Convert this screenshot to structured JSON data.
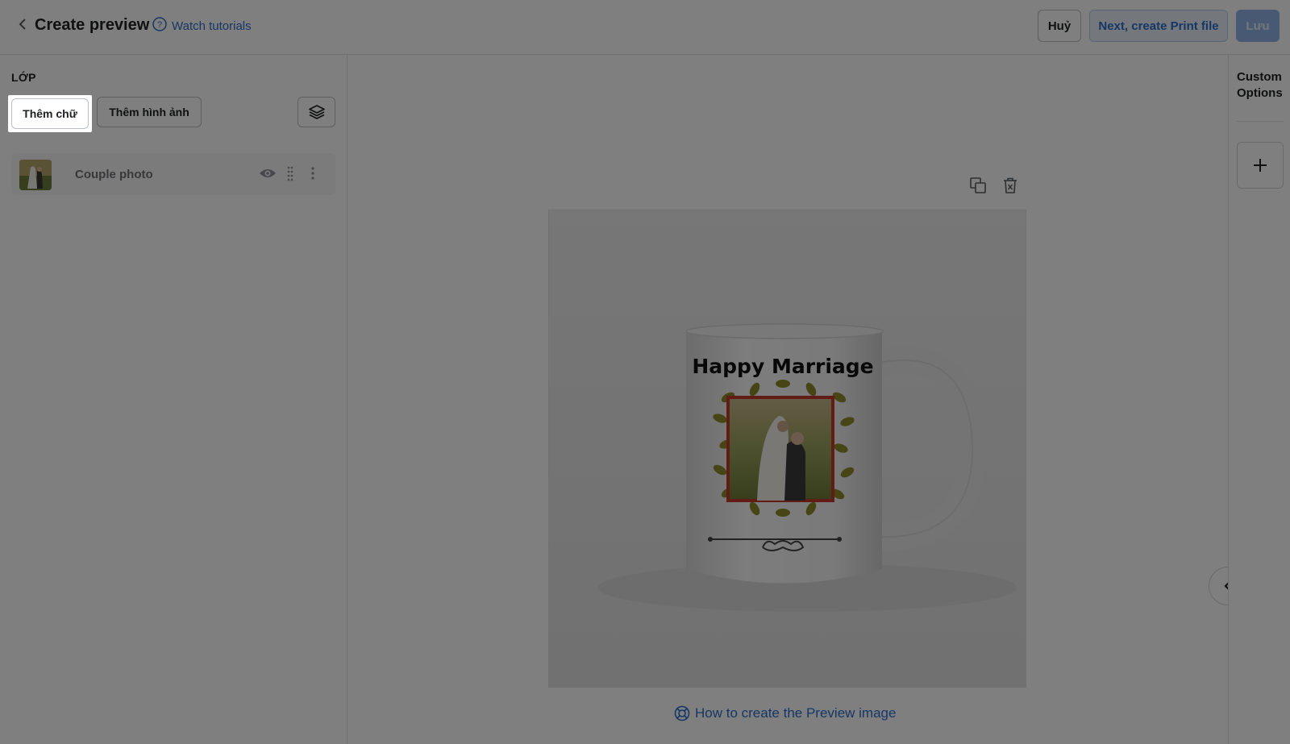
{
  "header": {
    "title": "Create preview",
    "tutorial_link": "Watch tutorials",
    "cancel_label": "Huỷ",
    "next_label": "Next, create Print file",
    "save_label": "Lưu"
  },
  "layers_panel": {
    "heading": "LỚP",
    "add_text_label": "Thêm chữ",
    "add_image_label": "Thêm hình ảnh",
    "layers": [
      {
        "name": "Couple photo"
      }
    ]
  },
  "right_panel": {
    "custom_options_label": "Custom Options",
    "add_icon": "plus-icon"
  },
  "canvas": {
    "mug_text": "Happy Marriage",
    "help_link": "How to create the Preview image"
  },
  "colors": {
    "accent": "#2c6ecb",
    "overlay": "rgba(0,0,0,0.5)",
    "frame_red": "#c0392b",
    "leaf": "#8a8a2a"
  }
}
